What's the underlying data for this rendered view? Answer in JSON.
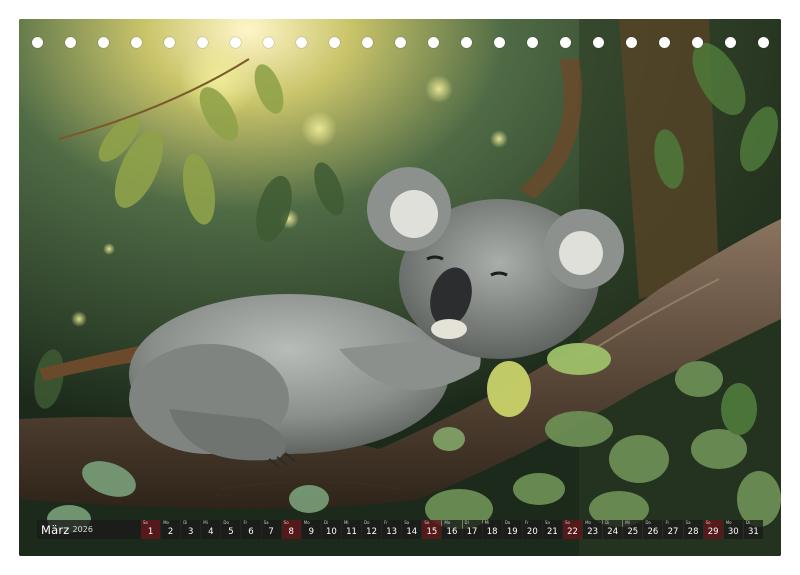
{
  "calendar": {
    "month": "März",
    "year": "2026",
    "days": [
      {
        "num": "1",
        "wd": "So",
        "sun": true
      },
      {
        "num": "2",
        "wd": "Mo",
        "sun": false
      },
      {
        "num": "3",
        "wd": "Di",
        "sun": false
      },
      {
        "num": "4",
        "wd": "Mi",
        "sun": false
      },
      {
        "num": "5",
        "wd": "Do",
        "sun": false
      },
      {
        "num": "6",
        "wd": "Fr",
        "sun": false
      },
      {
        "num": "7",
        "wd": "Sa",
        "sun": false
      },
      {
        "num": "8",
        "wd": "So",
        "sun": true
      },
      {
        "num": "9",
        "wd": "Mo",
        "sun": false
      },
      {
        "num": "10",
        "wd": "Di",
        "sun": false
      },
      {
        "num": "11",
        "wd": "Mi",
        "sun": false
      },
      {
        "num": "12",
        "wd": "Do",
        "sun": false
      },
      {
        "num": "13",
        "wd": "Fr",
        "sun": false
      },
      {
        "num": "14",
        "wd": "Sa",
        "sun": false
      },
      {
        "num": "15",
        "wd": "So",
        "sun": true
      },
      {
        "num": "16",
        "wd": "Mo",
        "sun": false
      },
      {
        "num": "17",
        "wd": "Di",
        "sun": false
      },
      {
        "num": "18",
        "wd": "Mi",
        "sun": false
      },
      {
        "num": "19",
        "wd": "Do",
        "sun": false
      },
      {
        "num": "20",
        "wd": "Fr",
        "sun": false
      },
      {
        "num": "21",
        "wd": "Sa",
        "sun": false
      },
      {
        "num": "22",
        "wd": "So",
        "sun": true
      },
      {
        "num": "23",
        "wd": "Mo",
        "sun": false
      },
      {
        "num": "24",
        "wd": "Di",
        "sun": false
      },
      {
        "num": "25",
        "wd": "Mi",
        "sun": false
      },
      {
        "num": "26",
        "wd": "Do",
        "sun": false
      },
      {
        "num": "27",
        "wd": "Fr",
        "sun": false
      },
      {
        "num": "28",
        "wd": "Sa",
        "sun": false
      },
      {
        "num": "29",
        "wd": "So",
        "sun": true
      },
      {
        "num": "30",
        "wd": "Mo",
        "sun": false
      },
      {
        "num": "31",
        "wd": "Di",
        "sun": false
      }
    ]
  },
  "colors": {
    "sunday_cell": "#5f161c",
    "weekday_cell": "#191919",
    "foliage": "#4f7a3a",
    "koala_fur": "#8a8f8c"
  }
}
